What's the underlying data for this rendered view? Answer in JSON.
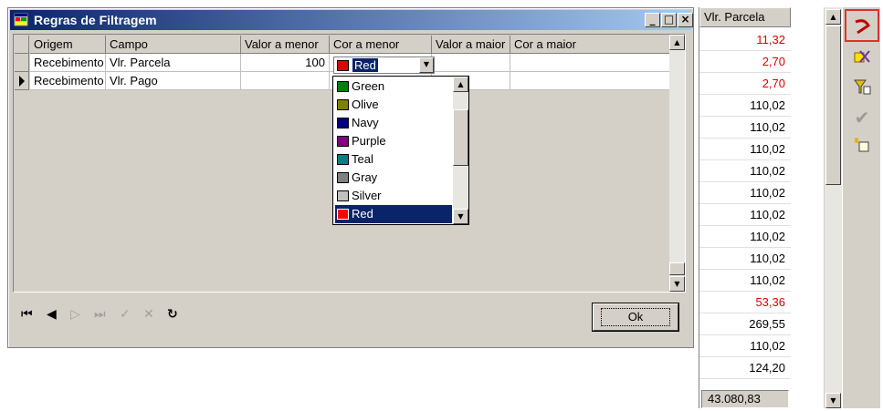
{
  "dialog": {
    "title": "Regras de Filtragem",
    "window_buttons": {
      "minimize": "_",
      "maximize": "□",
      "close": "×"
    }
  },
  "grid": {
    "columns": [
      "Origem",
      "Campo",
      "Valor a menor",
      "Cor a menor",
      "Valor a maior",
      "Cor a maior"
    ],
    "rows": [
      {
        "origem": "Recebimento",
        "campo": "Vlr. Parcela",
        "valor_menor": "100",
        "cor_menor": "Red",
        "valor_maior": "",
        "cor_maior": ""
      },
      {
        "origem": "Recebimento",
        "campo": "Vlr. Pago",
        "valor_menor": "",
        "cor_menor": "",
        "valor_maior": "",
        "cor_maior": ""
      }
    ]
  },
  "combo": {
    "value": "Red",
    "color": "#e00000"
  },
  "dropdown": {
    "options": [
      {
        "label": "Green",
        "color": "#008000"
      },
      {
        "label": "Olive",
        "color": "#808000"
      },
      {
        "label": "Navy",
        "color": "#000080"
      },
      {
        "label": "Purple",
        "color": "#800080"
      },
      {
        "label": "Teal",
        "color": "#008080"
      },
      {
        "label": "Gray",
        "color": "#808080"
      },
      {
        "label": "Silver",
        "color": "#c0c0c0"
      },
      {
        "label": "Red",
        "color": "#ff0000",
        "selected": true
      }
    ]
  },
  "navigator": {
    "icons": [
      "first-record-icon",
      "prior-record-icon",
      "next-record-icon",
      "last-record-icon",
      "post-icon",
      "cancel-icon",
      "refresh-icon"
    ]
  },
  "ok_button": "Ok",
  "right_panel": {
    "header": "Vlr. Parcela",
    "values": [
      {
        "text": "11,32",
        "color": "#e00000"
      },
      {
        "text": "2,70",
        "color": "#e00000"
      },
      {
        "text": "2,70",
        "color": "#e00000"
      },
      {
        "text": "110,02",
        "color": "#000000"
      },
      {
        "text": "110,02",
        "color": "#000000"
      },
      {
        "text": "110,02",
        "color": "#000000"
      },
      {
        "text": "110,02",
        "color": "#000000"
      },
      {
        "text": "110,02",
        "color": "#000000"
      },
      {
        "text": "110,02",
        "color": "#000000"
      },
      {
        "text": "110,02",
        "color": "#000000"
      },
      {
        "text": "110,02",
        "color": "#000000"
      },
      {
        "text": "110,02",
        "color": "#000000"
      },
      {
        "text": "53,36",
        "color": "#e00000"
      },
      {
        "text": "269,55",
        "color": "#000000"
      },
      {
        "text": "110,02",
        "color": "#000000"
      },
      {
        "text": "124,20",
        "color": "#000000"
      }
    ],
    "total": "43.080,83"
  },
  "toolbar": {
    "buttons": [
      "filter-rules-icon",
      "clear-filter-icon",
      "funnel-icon",
      "check-icon",
      "copy-icon"
    ]
  }
}
